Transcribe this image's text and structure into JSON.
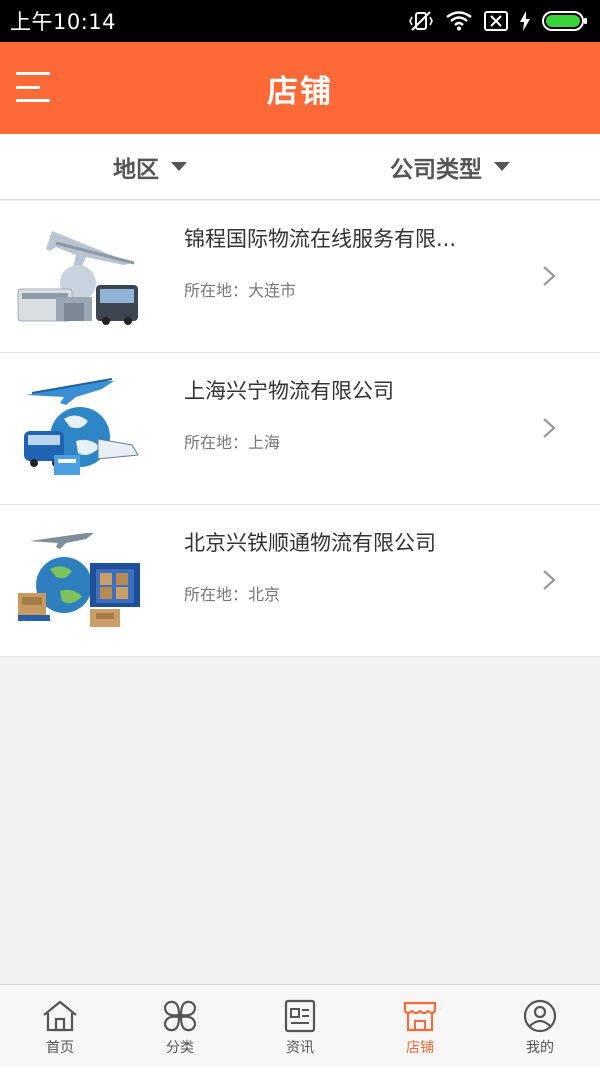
{
  "status_bar": {
    "time": "上午10:14"
  },
  "header": {
    "title": "店铺"
  },
  "filters": [
    {
      "label": "地区"
    },
    {
      "label": "公司类型"
    }
  ],
  "stores": [
    {
      "name": "锦程国际物流在线服务有限...",
      "location": "所在地：大连市"
    },
    {
      "name": "上海兴宁物流有限公司",
      "location": "所在地：上海"
    },
    {
      "name": "北京兴铁顺通物流有限公司",
      "location": "所在地：北京"
    }
  ],
  "bottom_nav": [
    {
      "label": "首页",
      "icon": "home-icon"
    },
    {
      "label": "分类",
      "icon": "category-icon"
    },
    {
      "label": "资讯",
      "icon": "news-icon"
    },
    {
      "label": "店铺",
      "icon": "store-icon",
      "active": true
    },
    {
      "label": "我的",
      "icon": "profile-icon"
    }
  ],
  "colors": {
    "accent": "#fd6937",
    "background": "#f2f2f2"
  }
}
